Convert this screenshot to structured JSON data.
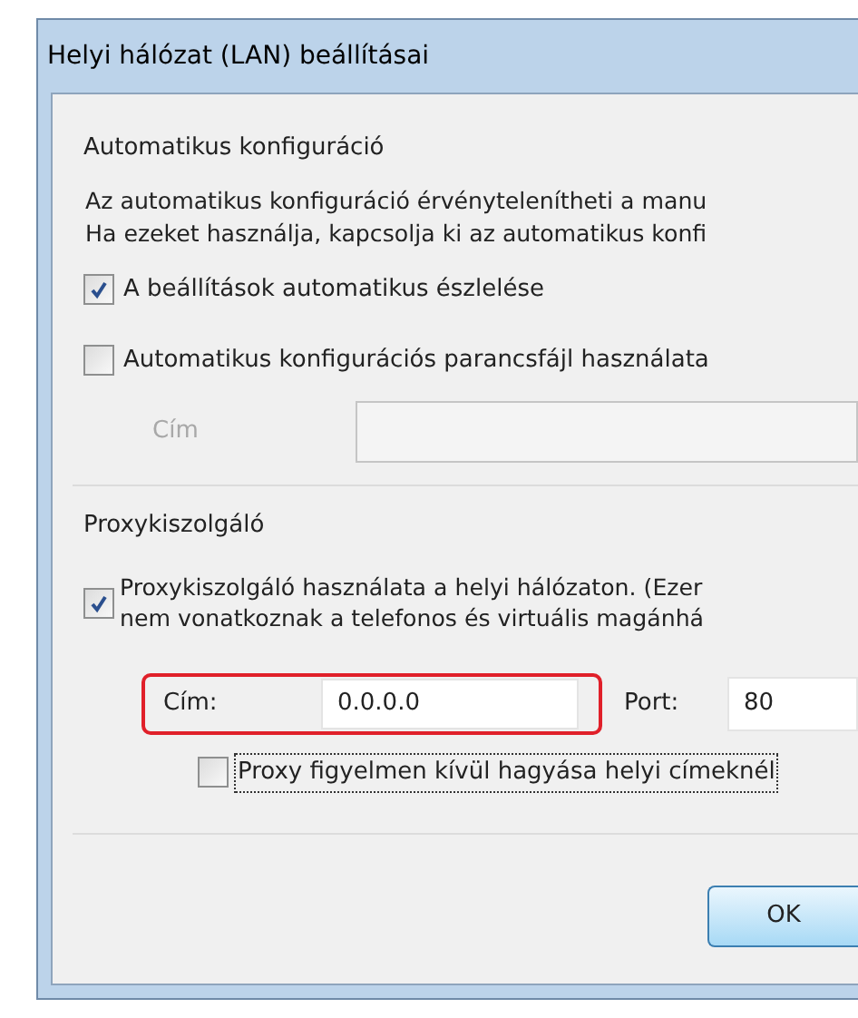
{
  "window": {
    "title": "Helyi hálózat (LAN) beállításai"
  },
  "auto_config": {
    "title": "Automatikus konfiguráció",
    "description": [
      "Az automatikus konfiguráció érvénytelenítheti a manu",
      "Ha ezeket használja, kapcsolja ki az automatikus konfi"
    ],
    "options": [
      {
        "label": "A beállítások automatikus észlelése",
        "checked": true
      },
      {
        "label": "Automatikus konfigurációs parancsfájl használata",
        "checked": false
      }
    ],
    "address": {
      "label": "Cím",
      "disabled": true
    }
  },
  "proxy": {
    "title": "Proxykiszolgáló",
    "use_proxy": {
      "label": [
        "Proxykiszolgáló használata a helyi hálózaton. (Ezer",
        "nem vonatkoznak a telefonos és virtuális magánhá"
      ],
      "checked": true
    },
    "address": {
      "label": "Cím:",
      "value": "0.0.0.0",
      "highlighted": true
    },
    "port": {
      "label": "Port:",
      "value": "80"
    },
    "bypass": {
      "label": "Proxy figyelmen kívül hagyása helyi címeknél",
      "checked": false,
      "focused": true
    }
  },
  "buttons": [
    {
      "label": "OK"
    }
  ]
}
